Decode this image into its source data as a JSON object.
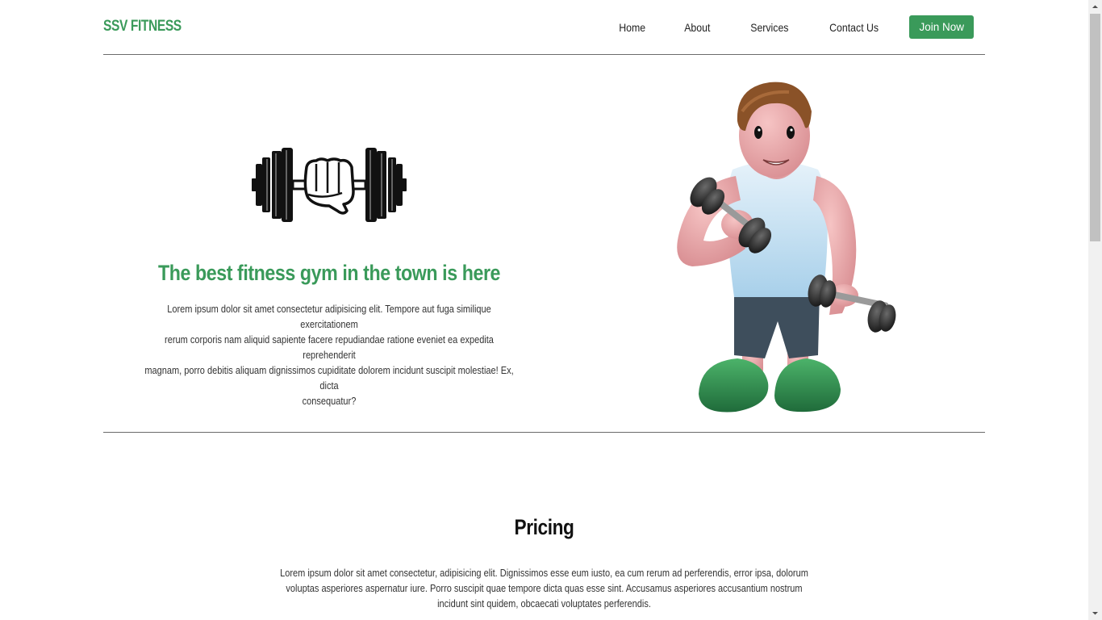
{
  "navbar": {
    "brand": "SSV FITNESS",
    "links": [
      "Home",
      "About",
      "Services",
      "Contact Us"
    ],
    "cta": "Join Now"
  },
  "hero": {
    "title": "The best fitness gym in the town is here",
    "text_lines": [
      "Lorem ipsum dolor sit amet consectetur adipisicing elit. Tempore aut fuga similique exercitationem",
      "rerum corporis nam aliquid sapiente facere repudiandae ratione eveniet ea expedita reprehenderit",
      "magnam, porro debitis aliquam dignissimos cupiditate dolorem incidunt suscipit molestiae! Ex, dicta",
      "consequatur?"
    ],
    "logo_icon": "dumbbell-fist-icon",
    "illustration": "muscle-man-lifting-dumbbells"
  },
  "pricing": {
    "title": "Pricing",
    "text": "Lorem ipsum dolor sit amet consectetur, adipisicing elit. Dignissimos esse eum iusto, ea cum rerum ad perferendis, error ipsa, dolorum voluptas asperiores aspernatur iure. Porro suscipit quae tempore dicta quas esse sint. Accusamus asperiores accusantium nostrum incidunt sint quidem, obcaecati voluptates perferendis."
  },
  "colors": {
    "accent": "#3a9a5a",
    "text": "#222222",
    "divider": "#6b6b6b"
  }
}
